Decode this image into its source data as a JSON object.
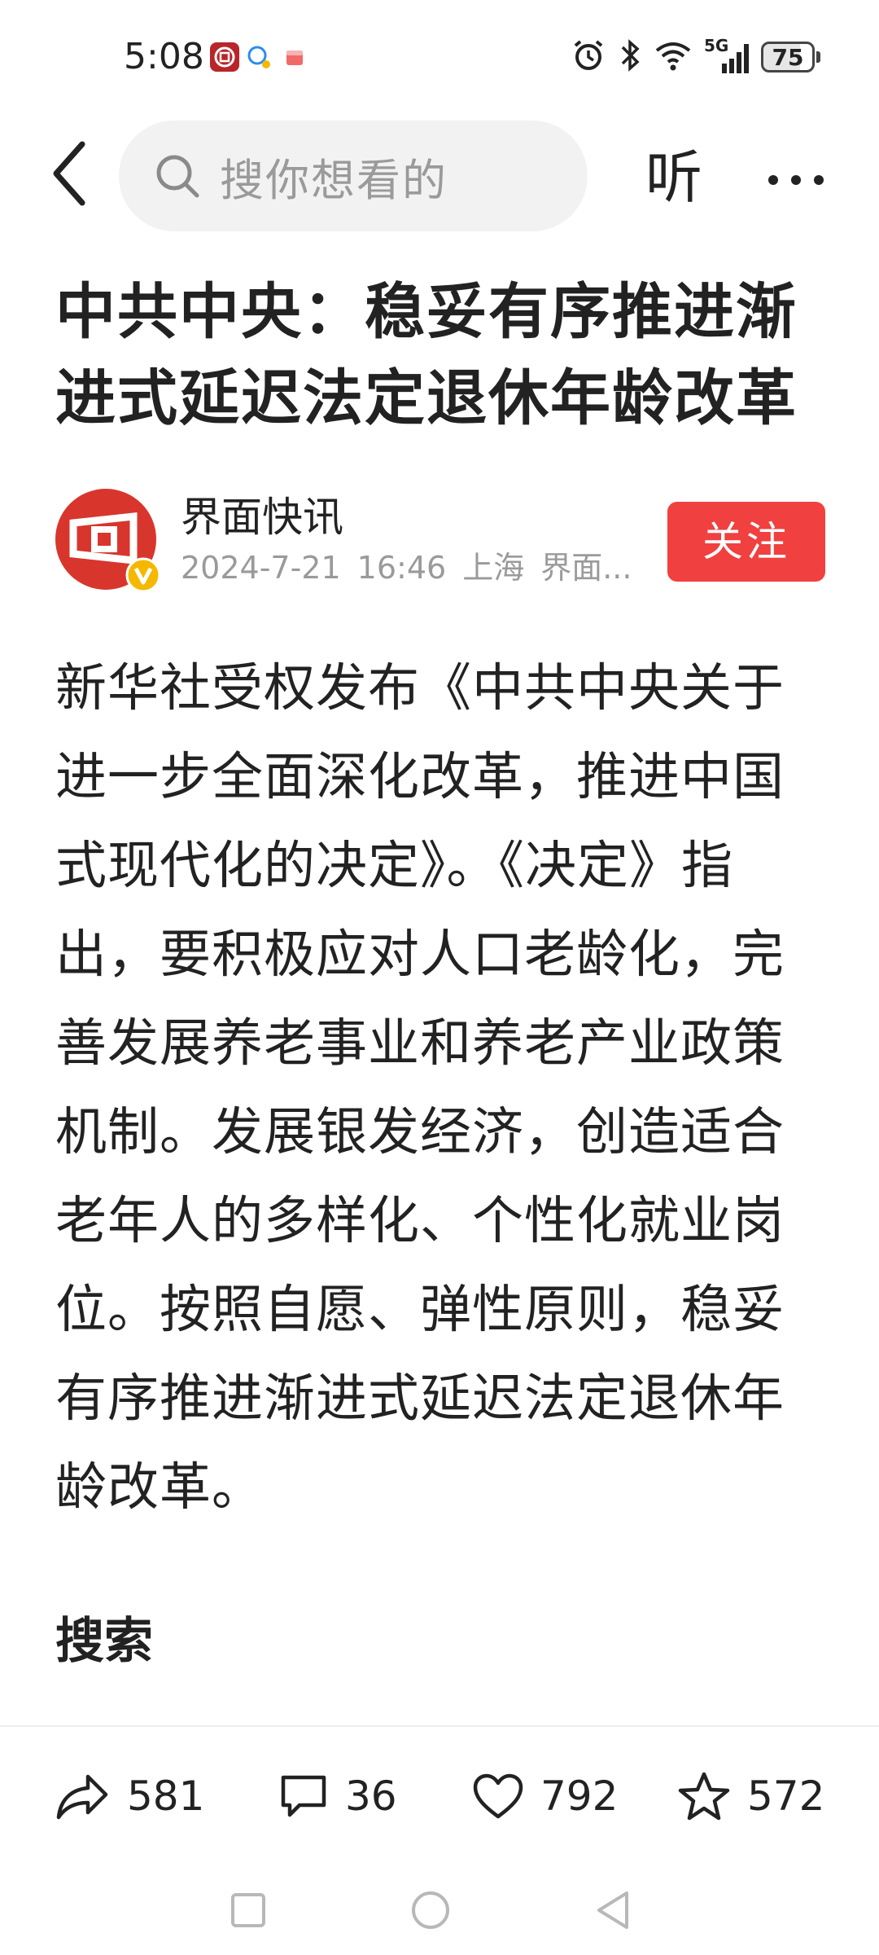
{
  "status_bar": {
    "time": "5:08",
    "network_label": "5G",
    "battery_level": "75",
    "battery_fraction": 0.75
  },
  "top_bar": {
    "search_placeholder": "搜你想看的",
    "listen_label": "听",
    "icons": [
      "back-arrow-icon",
      "search-icon",
      "more-icon"
    ]
  },
  "article": {
    "title": "中共中央：稳妥有序推进渐进式延迟法定退休年龄改革",
    "author": {
      "name": "界面快讯",
      "date": "2024-7-21",
      "time": "16:46",
      "location": "上海",
      "source": "界面..."
    },
    "follow_label": "关注",
    "body": "新华社受权发布《中共中央关于进一步全面深化改革，推进中国式现代化的决定》。《决定》指出，要积极应对人口老龄化，完善发展养老事业和养老产业政策机制。发展银发经济，创造适合老年人的多样化、个性化就业岗位。按照自愿、弹性原则，稳妥有序推进渐进式延迟法定退休年龄改革。",
    "section_heading": "搜索"
  },
  "actions": {
    "share_count": "581",
    "comment_count": "36",
    "like_count": "792",
    "favorite_count": "572"
  },
  "colors": {
    "accent_red": "#f0403f",
    "avatar_red": "#d8362d",
    "verified_yellow": "#f5b800",
    "search_bg": "#f2f2f2"
  }
}
